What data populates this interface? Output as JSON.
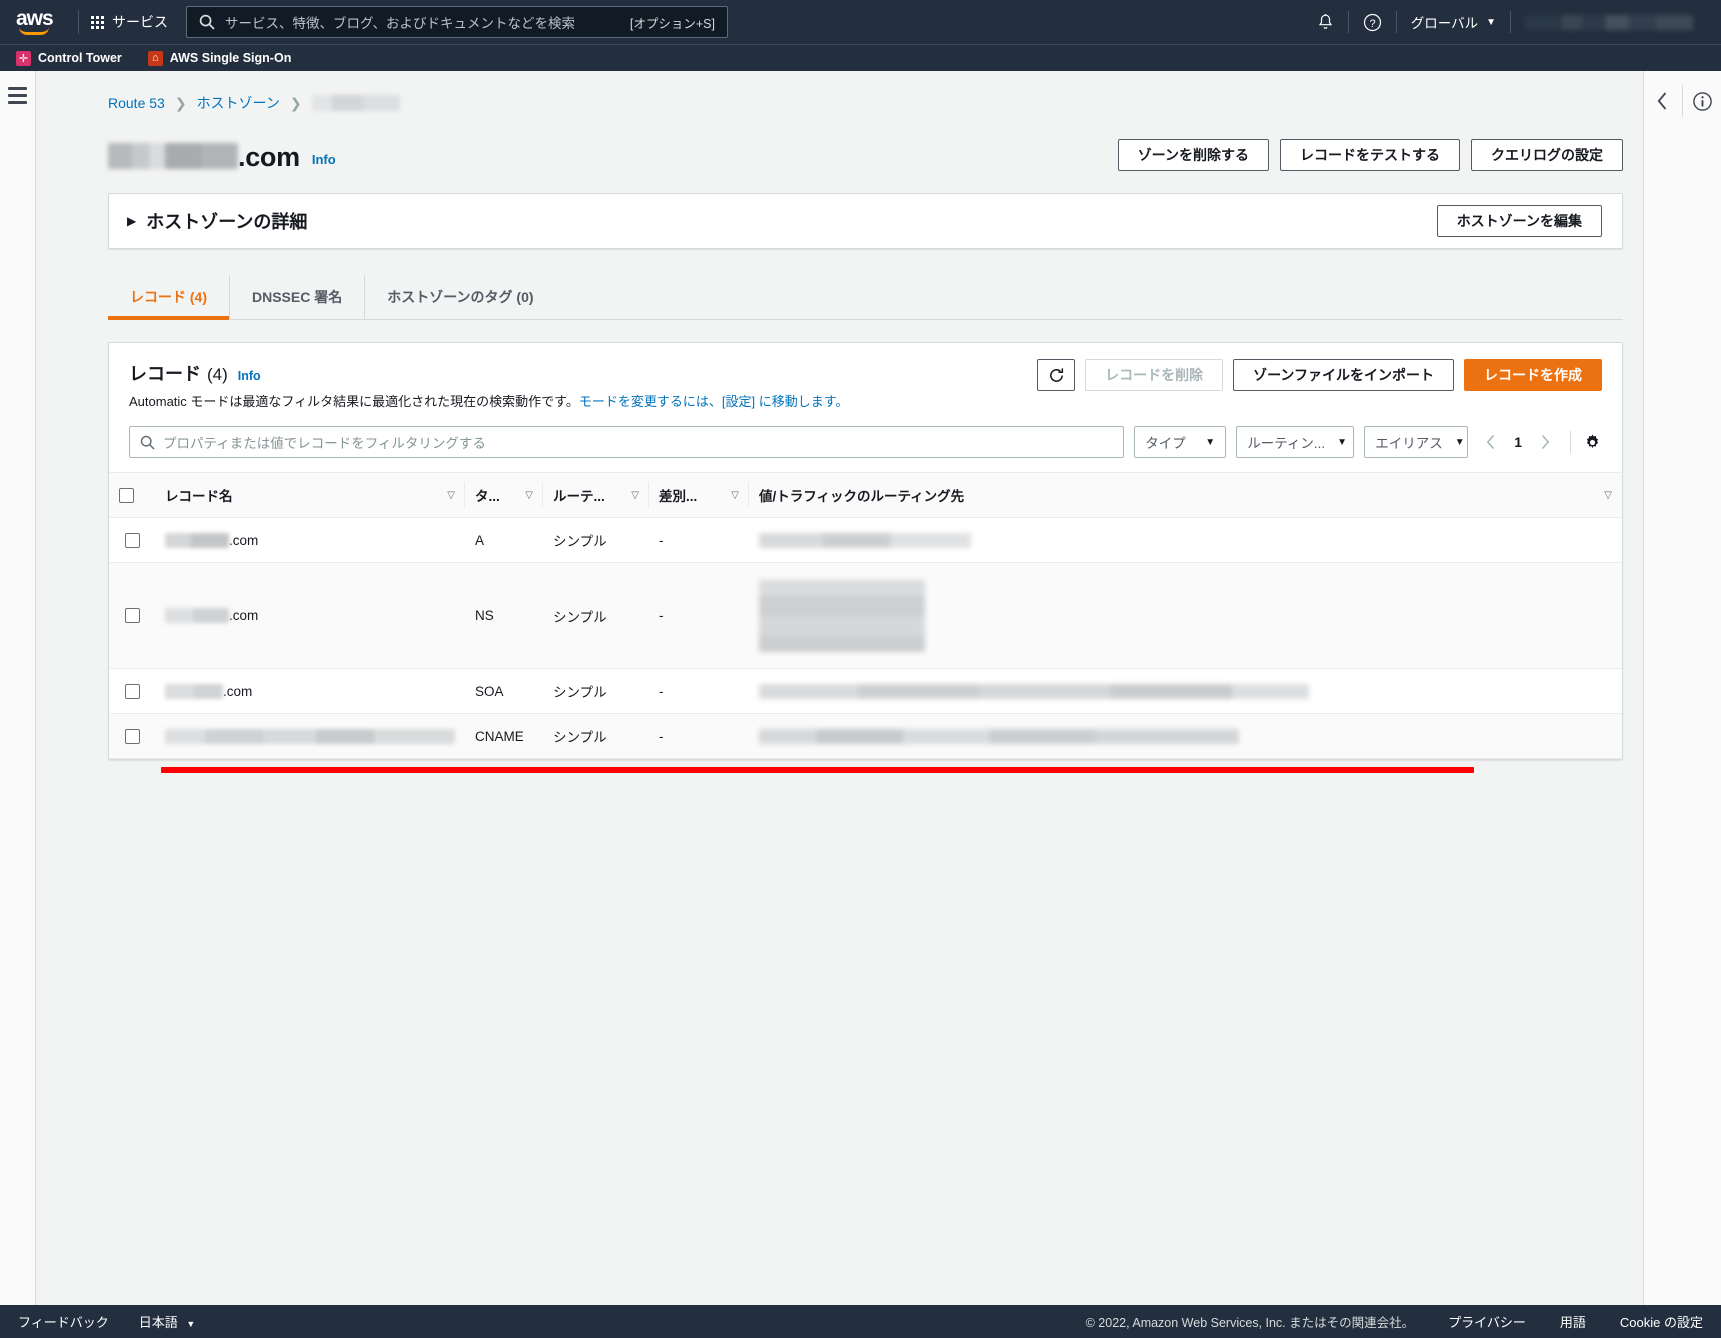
{
  "topnav": {
    "logo_alt": "aws",
    "services_label": "サービス",
    "search_placeholder": "サービス、特徴、ブログ、およびドキュメントなどを検索",
    "search_shortcut": "[オプション+S]",
    "search_value": "",
    "bell_icon": "notifications-bell-icon",
    "help_icon": "help-question-icon",
    "region_label": "グローバル",
    "account_label": "",
    "favorites": [
      {
        "label": "Control Tower",
        "icon": "control-tower-icon"
      },
      {
        "label": "AWS Single Sign-On",
        "icon": "sso-icon"
      }
    ]
  },
  "breadcrumb": {
    "items": [
      {
        "label": "Route 53",
        "link": true
      },
      {
        "label": "ホストゾーン",
        "link": true
      },
      {
        "label": "",
        "link": false,
        "redacted": true
      }
    ],
    "separator": "›"
  },
  "page": {
    "title_redacted": true,
    "title_suffix": ".com",
    "info_label": "Info",
    "actions": [
      {
        "label": "ゾーンを削除する",
        "name": "delete-zone-button"
      },
      {
        "label": "レコードをテストする",
        "name": "test-record-button"
      },
      {
        "label": "クエリログの設定",
        "name": "configure-query-log-button"
      }
    ]
  },
  "details_panel": {
    "title": "ホストゾーンの詳細",
    "expanded": false,
    "caret": "▶",
    "edit_label": "ホストゾーンを編集"
  },
  "tabs": [
    {
      "label": "レコード (4)",
      "active": true,
      "name": "tab-records"
    },
    {
      "label": "DNSSEC 署名",
      "active": false,
      "name": "tab-dnssec"
    },
    {
      "label": "ホストゾーンのタグ (0)",
      "active": false,
      "name": "tab-tags"
    }
  ],
  "records_card": {
    "title": "レコード",
    "count": "(4)",
    "info_label": "Info",
    "description_pre": "Automatic モードは最適なフィルタ結果に最適化された現在の検索動作です。",
    "description_link": "モードを変更するには、[設定] に移動します。",
    "refresh_icon": "refresh-icon",
    "delete_label": "レコードを削除",
    "delete_disabled": true,
    "import_label": "ゾーンファイルをインポート",
    "create_label": "レコードを作成",
    "create_color": "#ec7211",
    "filter_placeholder": "プロパティまたは値でレコードをフィルタリングする",
    "filter_value": "",
    "selects": [
      {
        "label": "タイプ",
        "name": "type-filter-select"
      },
      {
        "label": "ルーティン...",
        "name": "routing-filter-select"
      },
      {
        "label": "エイリアス",
        "name": "alias-filter-select"
      }
    ],
    "pagination": {
      "prev": "‹",
      "page": "1",
      "next": "›"
    },
    "settings_icon": "gear-icon",
    "columns": [
      {
        "label": "レコード名",
        "sortable": true
      },
      {
        "label": "タ...",
        "sortable": true
      },
      {
        "label": "ルーテ...",
        "sortable": true
      },
      {
        "label": "差別...",
        "sortable": true
      },
      {
        "label": "値/トラフィックのルーティング先",
        "sortable": true
      }
    ],
    "rows": [
      {
        "name_redacted": true,
        "name_suffix": ".com",
        "type": "A",
        "routing": "シンプル",
        "differentiator": "-",
        "value_redacted": true
      },
      {
        "name_redacted": true,
        "name_suffix": ".com",
        "type": "NS",
        "routing": "シンプル",
        "differentiator": "-",
        "value_redacted": true
      },
      {
        "name_redacted": true,
        "name_suffix": ".com",
        "type": "SOA",
        "routing": "シンプル",
        "differentiator": "-",
        "value_redacted": true
      },
      {
        "name_redacted": true,
        "name_suffix": "",
        "type": "CNAME",
        "routing": "シンプル",
        "differentiator": "-",
        "value_redacted": true
      }
    ]
  },
  "annotation": {
    "color": "#ff0000",
    "type": "underline-highlight"
  },
  "rightbar": {
    "collapse_icon": "chevron-left-icon",
    "info_icon": "info-circle-icon"
  },
  "leftbar": {
    "menu_icon": "hamburger-menu-icon"
  },
  "footer": {
    "feedback_label": "フィードバック",
    "language_label": "日本語",
    "copyright": "© 2022, Amazon Web Services, Inc. またはその関連会社。",
    "links": [
      "プライバシー",
      "用語",
      "Cookie の設定"
    ]
  }
}
